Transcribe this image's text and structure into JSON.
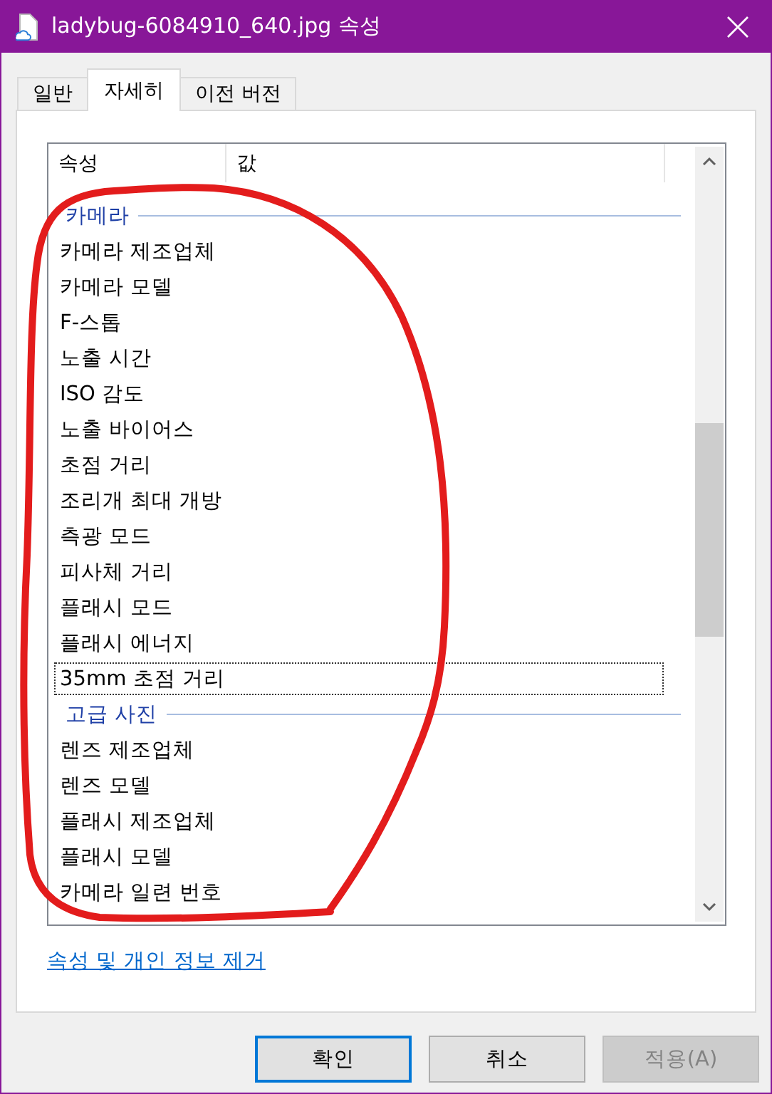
{
  "window": {
    "title": "ladybug-6084910_640.jpg 속성"
  },
  "tabs": [
    {
      "label": "일반",
      "selected": false
    },
    {
      "label": "자세히",
      "selected": true
    },
    {
      "label": "이전 버전",
      "selected": false
    }
  ],
  "property_list": {
    "columns": [
      "속성",
      "값"
    ],
    "rows": [
      {
        "kind": "group",
        "label": "카메라"
      },
      {
        "kind": "item",
        "label": "카메라 제조업체",
        "focused": false
      },
      {
        "kind": "item",
        "label": "카메라 모델",
        "focused": false
      },
      {
        "kind": "item",
        "label": "F-스톱",
        "focused": false
      },
      {
        "kind": "item",
        "label": "노출 시간",
        "focused": false
      },
      {
        "kind": "item",
        "label": "ISO 감도",
        "focused": false
      },
      {
        "kind": "item",
        "label": "노출 바이어스",
        "focused": false
      },
      {
        "kind": "item",
        "label": "초점 거리",
        "focused": false
      },
      {
        "kind": "item",
        "label": "조리개 최대 개방",
        "focused": false
      },
      {
        "kind": "item",
        "label": "측광 모드",
        "focused": false
      },
      {
        "kind": "item",
        "label": "피사체 거리",
        "focused": false
      },
      {
        "kind": "item",
        "label": "플래시 모드",
        "focused": false
      },
      {
        "kind": "item",
        "label": "플래시 에너지",
        "focused": false
      },
      {
        "kind": "item",
        "label": "35mm 초점 거리",
        "focused": true
      },
      {
        "kind": "group",
        "label": "고급 사진"
      },
      {
        "kind": "item",
        "label": "렌즈 제조업체",
        "focused": false
      },
      {
        "kind": "item",
        "label": "렌즈 모델",
        "focused": false
      },
      {
        "kind": "item",
        "label": "플래시 제조업체",
        "focused": false
      },
      {
        "kind": "item",
        "label": "플래시 모델",
        "focused": false
      },
      {
        "kind": "item",
        "label": "카메라 일련 번호",
        "focused": false
      }
    ]
  },
  "link": "속성 및 개인 정보 제거",
  "buttons": [
    {
      "label": "확인",
      "default": true,
      "disabled": false
    },
    {
      "label": "취소",
      "default": false,
      "disabled": false
    },
    {
      "label": "적용(A)",
      "default": false,
      "disabled": true
    }
  ]
}
